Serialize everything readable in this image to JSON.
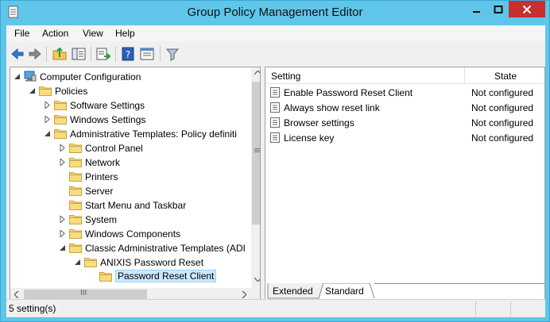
{
  "window": {
    "title": "Group Policy Management Editor",
    "accent": "#5fc6ea",
    "close_color": "#c7302c"
  },
  "menu": [
    "File",
    "Action",
    "View",
    "Help"
  ],
  "toolbar": {
    "buttons": [
      "back-icon",
      "forward-icon",
      "up-folder-icon",
      "show-hide-tree-icon",
      "export-list-icon",
      "help-icon",
      "properties-icon",
      "filter-icon"
    ]
  },
  "tree": {
    "items": [
      {
        "label": "Computer Configuration",
        "depth": 0,
        "expanded": "open",
        "icon": "computer-icon"
      },
      {
        "label": "Policies",
        "depth": 1,
        "expanded": "open",
        "icon": "folder-icon"
      },
      {
        "label": "Software Settings",
        "depth": 2,
        "expanded": "closed",
        "icon": "folder-icon"
      },
      {
        "label": "Windows Settings",
        "depth": 2,
        "expanded": "closed",
        "icon": "folder-icon"
      },
      {
        "label": "Administrative Templates: Policy definiti",
        "depth": 2,
        "expanded": "open",
        "icon": "folder-icon"
      },
      {
        "label": "Control Panel",
        "depth": 3,
        "expanded": "closed",
        "icon": "folder-icon"
      },
      {
        "label": "Network",
        "depth": 3,
        "expanded": "closed",
        "icon": "folder-icon"
      },
      {
        "label": "Printers",
        "depth": 3,
        "expanded": "none",
        "icon": "folder-icon"
      },
      {
        "label": "Server",
        "depth": 3,
        "expanded": "none",
        "icon": "folder-icon"
      },
      {
        "label": "Start Menu and Taskbar",
        "depth": 3,
        "expanded": "none",
        "icon": "folder-icon"
      },
      {
        "label": "System",
        "depth": 3,
        "expanded": "closed",
        "icon": "folder-icon"
      },
      {
        "label": "Windows Components",
        "depth": 3,
        "expanded": "closed",
        "icon": "folder-icon"
      },
      {
        "label": "Classic Administrative Templates (ADI",
        "depth": 3,
        "expanded": "open",
        "icon": "folder-icon"
      },
      {
        "label": "ANIXIS Password Reset",
        "depth": 4,
        "expanded": "open",
        "icon": "folder-icon"
      },
      {
        "label": "Password Reset Client",
        "depth": 5,
        "expanded": "none",
        "icon": "folder-icon",
        "selected": "yes"
      }
    ]
  },
  "details": {
    "columns": [
      "Setting",
      "State"
    ],
    "rows": [
      {
        "setting": "Enable Password Reset Client",
        "state": "Not configured"
      },
      {
        "setting": "Always show reset link",
        "state": "Not configured"
      },
      {
        "setting": "Browser settings",
        "state": "Not configured"
      },
      {
        "setting": "License key",
        "state": "Not configured"
      }
    ]
  },
  "tabs": [
    "Extended",
    "Standard"
  ],
  "tabs_active": "Standard",
  "status": {
    "text": "5 setting(s)"
  },
  "scrollbar": {
    "hthumb_glyph": "III"
  }
}
